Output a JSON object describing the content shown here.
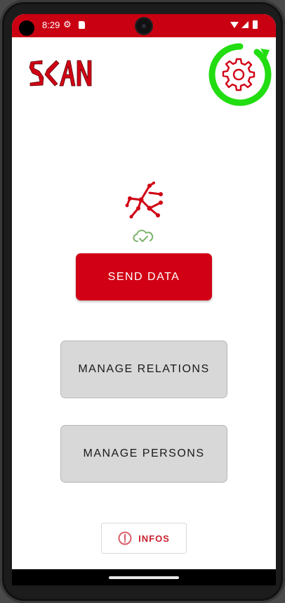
{
  "status_bar": {
    "time": "8:29",
    "background": "#c90012"
  },
  "app": {
    "logo_text": "SCAN",
    "accent_color": "#d10014"
  },
  "header": {
    "settings_icon": "gear-icon",
    "settings_highlight_color": "#22dd11"
  },
  "sync": {
    "network_icon": "network-graph-icon",
    "cloud_icon": "cloud-check-icon",
    "cloud_color": "#7cb36a"
  },
  "actions": {
    "send_data_label": "SEND DATA",
    "manage_relations_label": "MANAGE RELATIONS",
    "manage_persons_label": "MANAGE PERSONS",
    "infos_label": "INFOS",
    "infos_icon": "info-circle-icon"
  }
}
